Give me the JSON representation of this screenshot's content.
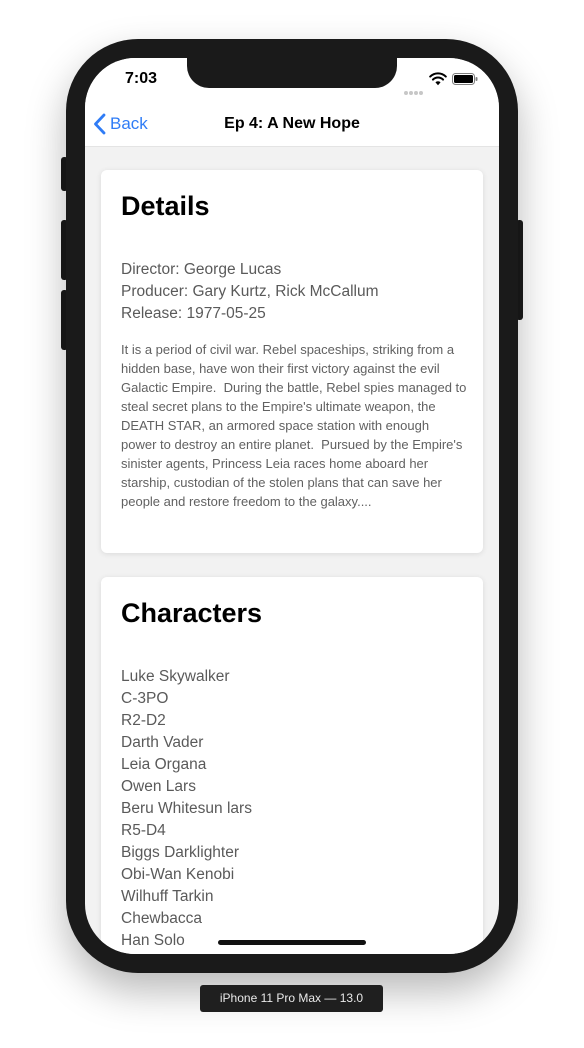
{
  "status_bar": {
    "time": "7:03",
    "icons": [
      "signal-icon",
      "wifi-icon",
      "battery-icon"
    ]
  },
  "nav": {
    "back_label": "Back",
    "title": "Ep 4: A New Hope",
    "back_icon": "chevron-left-icon"
  },
  "details": {
    "heading": "Details",
    "director": "Director: George Lucas",
    "producer": "Producer: Gary Kurtz, Rick McCallum",
    "release": "Release: 1977-05-25",
    "opening_crawl": "It is a period of civil war. Rebel spaceships, striking from a hidden base, have won their first victory against the evil Galactic Empire.  During the battle, Rebel spies managed to steal secret plans to the Empire's ultimate weapon, the DEATH STAR, an armored space station with enough power to destroy an entire planet.  Pursued by the Empire's sinister agents, Princess Leia races home aboard her starship, custodian of the stolen plans that can save her people and restore freedom to the galaxy...."
  },
  "characters": {
    "heading": "Characters",
    "items": [
      "Luke Skywalker",
      "C-3PO",
      "R2-D2",
      "Darth Vader",
      "Leia Organa",
      "Owen Lars",
      "Beru Whitesun lars",
      "R5-D4",
      "Biggs Darklighter",
      "Obi-Wan Kenobi",
      "Wilhuff Tarkin",
      "Chewbacca",
      "Han Solo"
    ]
  },
  "device_label": "iPhone 11 Pro Max — 13.0",
  "colors": {
    "accent": "#2f7cf6",
    "background": "#f2f2f2",
    "card": "#ffffff"
  }
}
